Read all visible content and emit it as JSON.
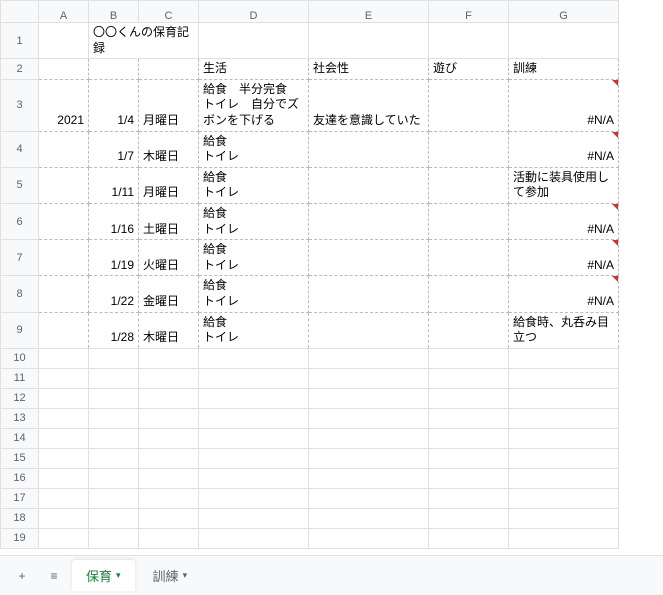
{
  "columns": [
    "A",
    "B",
    "C",
    "D",
    "E",
    "F",
    "G"
  ],
  "row_headers": [
    "1",
    "2",
    "3",
    "4",
    "5",
    "6",
    "7",
    "8",
    "9",
    "10",
    "11",
    "12",
    "13",
    "14",
    "15",
    "16",
    "17",
    "18",
    "19"
  ],
  "title": "〇〇くんの保育記録",
  "headers": {
    "D": "生活",
    "E": "社会性",
    "F": "遊び",
    "G": "訓練"
  },
  "rows": [
    {
      "A": "2021",
      "B": "1/4",
      "C": "月曜日",
      "D": "給食　半分完食\nトイレ　自分でズボンを下げる",
      "E": "友達を意識していた",
      "F": "",
      "G": "#N/A"
    },
    {
      "A": "",
      "B": "1/7",
      "C": "木曜日",
      "D": "給食\nトイレ",
      "E": "",
      "F": "",
      "G": "#N/A"
    },
    {
      "A": "",
      "B": "1/11",
      "C": "月曜日",
      "D": "給食\nトイレ",
      "E": "",
      "F": "",
      "G": "活動に装具使用して参加"
    },
    {
      "A": "",
      "B": "1/16",
      "C": "土曜日",
      "D": "給食\nトイレ",
      "E": "",
      "F": "",
      "G": "#N/A"
    },
    {
      "A": "",
      "B": "1/19",
      "C": "火曜日",
      "D": "給食\nトイレ",
      "E": "",
      "F": "",
      "G": "#N/A"
    },
    {
      "A": "",
      "B": "1/22",
      "C": "金曜日",
      "D": "給食\nトイレ",
      "E": "",
      "F": "",
      "G": "#N/A"
    },
    {
      "A": "",
      "B": "1/28",
      "C": "木曜日",
      "D": "給食\nトイレ",
      "E": "",
      "F": "",
      "G": "給食時、丸呑み目立つ"
    }
  ],
  "tabs": {
    "active": "保育",
    "other": "訓練"
  },
  "icons": {
    "plus": "+",
    "menu": "≡",
    "arrow": "▾"
  }
}
